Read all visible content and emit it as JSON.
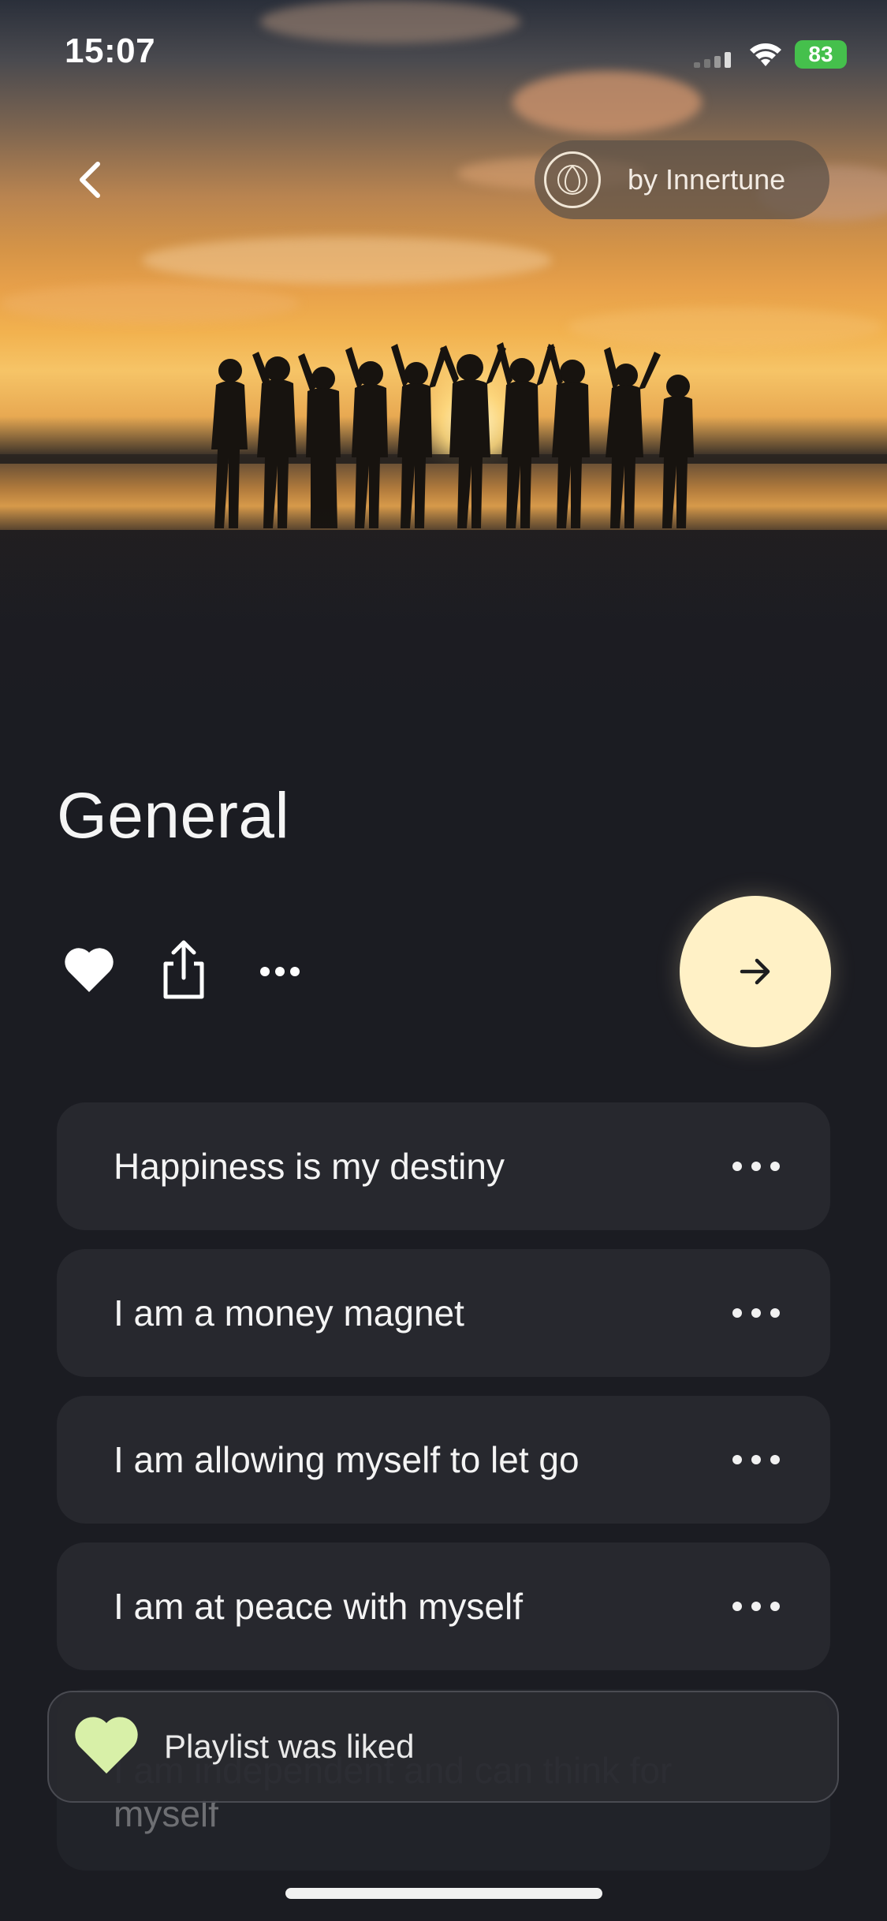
{
  "status_bar": {
    "time": "15:07",
    "battery": "83"
  },
  "header": {
    "back_icon": "chevron-left-icon",
    "brand_label": "by Innertune",
    "brand_icon": "innertune-logo"
  },
  "playlist": {
    "title": "General",
    "liked": true,
    "play_icon": "arrow-right-icon"
  },
  "tracks": [
    {
      "label": "Happiness is my destiny"
    },
    {
      "label": "I am a money magnet"
    },
    {
      "label": "I am allowing myself to let go"
    },
    {
      "label": "I am at peace with myself"
    },
    {
      "label": "I am independent and can think for myself"
    }
  ],
  "toast": {
    "message": "Playlist was liked",
    "icon": "heart-icon",
    "icon_color": "#d8f0a8"
  },
  "colors": {
    "background": "#1b1c22",
    "card": "#27282e",
    "play_button": "#fff1c6",
    "battery": "#45c04c"
  }
}
